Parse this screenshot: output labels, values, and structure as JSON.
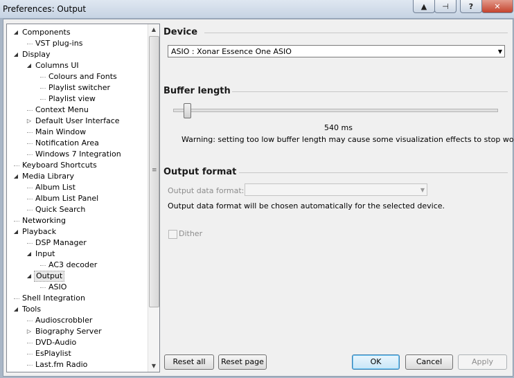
{
  "window": {
    "title": "Preferences: Output"
  },
  "titlebar": {
    "help": "?",
    "close": "✕"
  },
  "tree": {
    "items": [
      {
        "label": "Components",
        "level": 0,
        "expander": "open"
      },
      {
        "label": "VST plug-ins",
        "level": 1,
        "expander": ""
      },
      {
        "label": "Display",
        "level": 0,
        "expander": "open"
      },
      {
        "label": "Columns UI",
        "level": 1,
        "expander": "open"
      },
      {
        "label": "Colours and Fonts",
        "level": 2,
        "expander": ""
      },
      {
        "label": "Playlist switcher",
        "level": 2,
        "expander": ""
      },
      {
        "label": "Playlist view",
        "level": 2,
        "expander": ""
      },
      {
        "label": "Context Menu",
        "level": 1,
        "expander": ""
      },
      {
        "label": "Default User Interface",
        "level": 1,
        "expander": "closed"
      },
      {
        "label": "Main Window",
        "level": 1,
        "expander": ""
      },
      {
        "label": "Notification Area",
        "level": 1,
        "expander": ""
      },
      {
        "label": "Windows 7 Integration",
        "level": 1,
        "expander": ""
      },
      {
        "label": "Keyboard Shortcuts",
        "level": 0,
        "expander": ""
      },
      {
        "label": "Media Library",
        "level": 0,
        "expander": "open"
      },
      {
        "label": "Album List",
        "level": 1,
        "expander": ""
      },
      {
        "label": "Album List Panel",
        "level": 1,
        "expander": ""
      },
      {
        "label": "Quick Search",
        "level": 1,
        "expander": ""
      },
      {
        "label": "Networking",
        "level": 0,
        "expander": ""
      },
      {
        "label": "Playback",
        "level": 0,
        "expander": "open"
      },
      {
        "label": "DSP Manager",
        "level": 1,
        "expander": ""
      },
      {
        "label": "Input",
        "level": 1,
        "expander": "open"
      },
      {
        "label": "AC3 decoder",
        "level": 2,
        "expander": ""
      },
      {
        "label": "Output",
        "level": 1,
        "expander": "open",
        "selected": true
      },
      {
        "label": "ASIO",
        "level": 2,
        "expander": ""
      },
      {
        "label": "Shell Integration",
        "level": 0,
        "expander": ""
      },
      {
        "label": "Tools",
        "level": 0,
        "expander": "open"
      },
      {
        "label": "Audioscrobbler",
        "level": 1,
        "expander": ""
      },
      {
        "label": "Biography Server",
        "level": 1,
        "expander": "closed"
      },
      {
        "label": "DVD-Audio",
        "level": 1,
        "expander": ""
      },
      {
        "label": "EsPlaylist",
        "level": 1,
        "expander": ""
      },
      {
        "label": "Last.fm Radio",
        "level": 1,
        "expander": ""
      }
    ]
  },
  "device": {
    "heading": "Device",
    "selected": "ASIO : Xonar Essence One ASIO"
  },
  "buffer": {
    "heading": "Buffer length",
    "value_label": "540 ms",
    "slider_fraction": 0.04,
    "warning": "Warning: setting too low buffer length may cause some visualization effects to stop working."
  },
  "output_format": {
    "heading": "Output format",
    "field_label": "Output data format:",
    "field_value": "",
    "note": "Output data format will be chosen automatically for the selected device.",
    "dither_label": "Dither"
  },
  "buttons": {
    "reset_all": "Reset all",
    "reset_page": "Reset page",
    "ok": "OK",
    "cancel": "Cancel",
    "apply": "Apply"
  }
}
